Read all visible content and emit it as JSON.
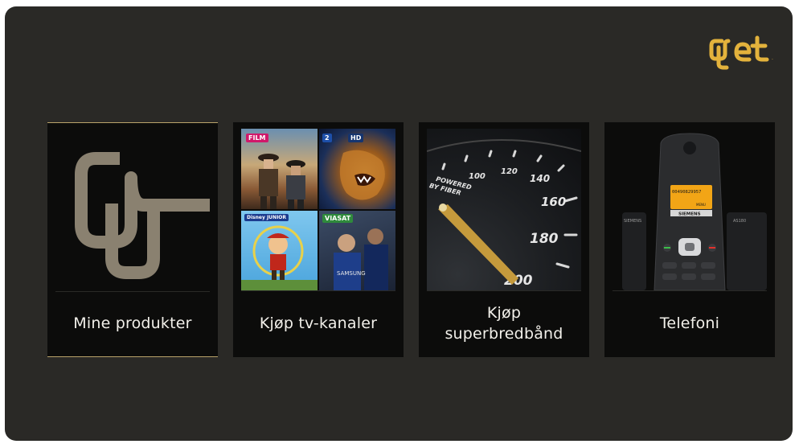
{
  "brand": {
    "logo_text": "get"
  },
  "tiles": [
    {
      "id": "mine-produkter",
      "label": "Mine produkter",
      "selected": true
    },
    {
      "id": "kjop-tv-kanaler",
      "label": "Kjøp tv-kanaler",
      "selected": false,
      "badges": [
        "FILM",
        "2",
        "HD",
        "VIASAT"
      ]
    },
    {
      "id": "kjop-superbredband",
      "label": "Kjøp superbredbånd",
      "selected": false,
      "gauge_text": "POWERED BY FIBER",
      "gauge_ticks": [
        "100",
        "120",
        "140",
        "160",
        "180",
        "200"
      ]
    },
    {
      "id": "telefoni",
      "label": "Telefoni",
      "selected": false,
      "phone_display": "00490829957",
      "phone_brand": "SIEMENS",
      "phone_menu": "MENU",
      "phone_model": "AS180"
    }
  ],
  "colors": {
    "accent_gold": "#e3b23c",
    "panel": "#2a2926",
    "tile": "#0c0c0b",
    "selected_border": "#b9a36a"
  }
}
